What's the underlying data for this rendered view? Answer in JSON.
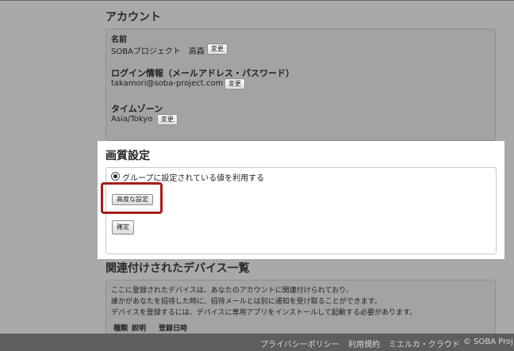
{
  "account": {
    "title": "アカウント",
    "name_label": "名前",
    "name_value": "SOBAプロジェクト　高森",
    "change_label": "変更",
    "login_label": "ログイン情報（メールアドレス・パスワード）",
    "login_value": "takamori@soba-project.com",
    "timezone_label": "タイムゾーン",
    "timezone_value": "Asia/Tokyo"
  },
  "quality": {
    "title": "画質設定",
    "radio_label": "グループに設定されている値を利用する",
    "advanced_button": "高度な設定",
    "confirm_button": "確定"
  },
  "devices": {
    "title": "関連付けされたデバイス一覧",
    "line1": "ここに登録されたデバイスは、あなたのアカウントに関連付けられており、",
    "line2": "誰かがあなたを招待した時に、招待メールとは別に通知を受け取ることができます。",
    "line3": "デバイスを登録するには、デバイスに専用アプリをインストールして起動する必要があります。",
    "col_type": "種類",
    "col_desc": "説明",
    "col_date": "登録日時"
  },
  "footer": {
    "privacy": "プライバシーポリシー",
    "terms": "利用規約",
    "brand": "ミエルカ・クラウド",
    "copyright": "© SOBA Proj"
  }
}
